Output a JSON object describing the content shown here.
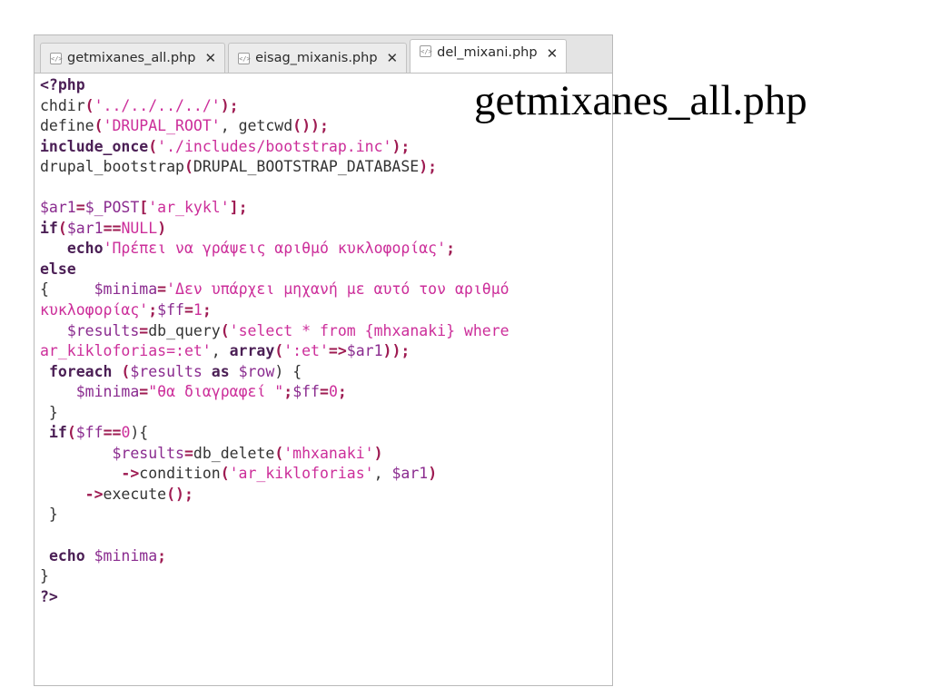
{
  "slide_title": "getmixanes_all.php",
  "editor": {
    "tabs": [
      {
        "label": "getmixanes_all.php",
        "icon": "php-file-icon",
        "close": "✕",
        "active": false
      },
      {
        "label": "eisag_mixanis.php",
        "icon": "php-file-icon",
        "close": "✕",
        "active": false
      },
      {
        "label": "del_mixani.php",
        "icon": "php-file-icon",
        "close": "✕",
        "active": true
      }
    ],
    "tab_icon_glyph": "</>",
    "code_lines": [
      [
        {
          "t": "<?php",
          "c": "kw"
        }
      ],
      [
        {
          "t": "chdir",
          "c": "fn"
        },
        {
          "t": "(",
          "c": "punc"
        },
        {
          "t": "'../../../../'",
          "c": "str"
        },
        {
          "t": ");",
          "c": "punc"
        }
      ],
      [
        {
          "t": "define",
          "c": "fn"
        },
        {
          "t": "(",
          "c": "punc"
        },
        {
          "t": "'DRUPAL_ROOT'",
          "c": "str"
        },
        {
          "t": ", ",
          "c": "plain"
        },
        {
          "t": "getcwd",
          "c": "fn"
        },
        {
          "t": "());",
          "c": "punc"
        }
      ],
      [
        {
          "t": "include_once",
          "c": "kw"
        },
        {
          "t": "(",
          "c": "punc"
        },
        {
          "t": "'./includes/bootstrap.inc'",
          "c": "str"
        },
        {
          "t": ");",
          "c": "punc"
        }
      ],
      [
        {
          "t": "drupal_bootstrap",
          "c": "fn"
        },
        {
          "t": "(",
          "c": "punc"
        },
        {
          "t": "DRUPAL_BOOTSTRAP_DATABASE",
          "c": "plain"
        },
        {
          "t": ");",
          "c": "punc"
        }
      ],
      [],
      [
        {
          "t": "$ar1",
          "c": "var"
        },
        {
          "t": "=",
          "c": "punc"
        },
        {
          "t": "$_POST",
          "c": "var"
        },
        {
          "t": "[",
          "c": "punc"
        },
        {
          "t": "'ar_kykl'",
          "c": "str"
        },
        {
          "t": "];",
          "c": "punc"
        }
      ],
      [
        {
          "t": "if",
          "c": "kw"
        },
        {
          "t": "(",
          "c": "punc"
        },
        {
          "t": "$ar1",
          "c": "var"
        },
        {
          "t": "==",
          "c": "punc"
        },
        {
          "t": "NULL",
          "c": "const"
        },
        {
          "t": ")",
          "c": "punc"
        }
      ],
      [
        {
          "t": "   ",
          "c": "plain"
        },
        {
          "t": "echo",
          "c": "kw"
        },
        {
          "t": "'Πρέπει να γράψεις αριθμό κυκλοφορίας'",
          "c": "str"
        },
        {
          "t": ";",
          "c": "punc"
        }
      ],
      [
        {
          "t": "else",
          "c": "kw"
        }
      ],
      [
        {
          "t": "{     ",
          "c": "plain"
        },
        {
          "t": "$minima",
          "c": "var"
        },
        {
          "t": "=",
          "c": "punc"
        },
        {
          "t": "'Δεν υπάρχει μηχανή με αυτό τον αριθμό",
          "c": "str"
        }
      ],
      [
        {
          "t": "κυκλοφορίας'",
          "c": "str"
        },
        {
          "t": ";",
          "c": "punc"
        },
        {
          "t": "$ff",
          "c": "var"
        },
        {
          "t": "=",
          "c": "punc"
        },
        {
          "t": "1",
          "c": "num"
        },
        {
          "t": ";",
          "c": "punc"
        }
      ],
      [
        {
          "t": "   ",
          "c": "plain"
        },
        {
          "t": "$results",
          "c": "var"
        },
        {
          "t": "=",
          "c": "punc"
        },
        {
          "t": "db_query",
          "c": "fn"
        },
        {
          "t": "(",
          "c": "punc"
        },
        {
          "t": "'select * from {mhxanaki} where",
          "c": "str"
        }
      ],
      [
        {
          "t": "ar_kikloforias=:et'",
          "c": "str"
        },
        {
          "t": ", ",
          "c": "plain"
        },
        {
          "t": "array",
          "c": "kw"
        },
        {
          "t": "(",
          "c": "punc"
        },
        {
          "t": "':et'",
          "c": "str"
        },
        {
          "t": "=>",
          "c": "punc"
        },
        {
          "t": "$ar1",
          "c": "var"
        },
        {
          "t": "));",
          "c": "punc"
        }
      ],
      [
        {
          "t": " ",
          "c": "plain"
        },
        {
          "t": "foreach",
          "c": "kw"
        },
        {
          "t": " (",
          "c": "punc"
        },
        {
          "t": "$results",
          "c": "var"
        },
        {
          "t": " ",
          "c": "plain"
        },
        {
          "t": "as",
          "c": "kw"
        },
        {
          "t": " ",
          "c": "plain"
        },
        {
          "t": "$row",
          "c": "var"
        },
        {
          "t": ") {",
          "c": "plain"
        }
      ],
      [
        {
          "t": "    ",
          "c": "plain"
        },
        {
          "t": "$minima",
          "c": "var"
        },
        {
          "t": "=",
          "c": "punc"
        },
        {
          "t": "\"θα διαγραφεί \"",
          "c": "str"
        },
        {
          "t": ";",
          "c": "punc"
        },
        {
          "t": "$ff",
          "c": "var"
        },
        {
          "t": "=",
          "c": "punc"
        },
        {
          "t": "0",
          "c": "num"
        },
        {
          "t": ";",
          "c": "punc"
        }
      ],
      [
        {
          "t": " }",
          "c": "plain"
        }
      ],
      [
        {
          "t": " ",
          "c": "plain"
        },
        {
          "t": "if",
          "c": "kw"
        },
        {
          "t": "(",
          "c": "punc"
        },
        {
          "t": "$ff",
          "c": "var"
        },
        {
          "t": "==",
          "c": "punc"
        },
        {
          "t": "0",
          "c": "num"
        },
        {
          "t": "){",
          "c": "plain"
        }
      ],
      [
        {
          "t": "        ",
          "c": "plain"
        },
        {
          "t": "$results",
          "c": "var"
        },
        {
          "t": "=",
          "c": "punc"
        },
        {
          "t": "db_delete",
          "c": "fn"
        },
        {
          "t": "(",
          "c": "punc"
        },
        {
          "t": "'mhxanaki'",
          "c": "str"
        },
        {
          "t": ")",
          "c": "punc"
        }
      ],
      [
        {
          "t": "         ",
          "c": "plain"
        },
        {
          "t": "->",
          "c": "punc"
        },
        {
          "t": "condition",
          "c": "fn"
        },
        {
          "t": "(",
          "c": "punc"
        },
        {
          "t": "'ar_kikloforias'",
          "c": "str"
        },
        {
          "t": ", ",
          "c": "plain"
        },
        {
          "t": "$ar1",
          "c": "var"
        },
        {
          "t": ")",
          "c": "punc"
        }
      ],
      [
        {
          "t": "     ",
          "c": "plain"
        },
        {
          "t": "->",
          "c": "punc"
        },
        {
          "t": "execute",
          "c": "fn"
        },
        {
          "t": "();",
          "c": "punc"
        }
      ],
      [
        {
          "t": " }",
          "c": "plain"
        }
      ],
      [],
      [
        {
          "t": " ",
          "c": "plain"
        },
        {
          "t": "echo",
          "c": "kw"
        },
        {
          "t": " ",
          "c": "plain"
        },
        {
          "t": "$minima",
          "c": "var"
        },
        {
          "t": ";",
          "c": "punc"
        }
      ],
      [
        {
          "t": "}",
          "c": "plain"
        }
      ],
      [
        {
          "t": "?>",
          "c": "kw"
        }
      ]
    ]
  },
  "colors": {
    "keyword": "#4b1f55",
    "variable": "#8a2b8f",
    "string": "#cc2e9a",
    "punctuation": "#9e1b52",
    "plain": "#333333",
    "tabbar_bg": "#e4e4e4",
    "change_marker": "#4a90c8"
  }
}
